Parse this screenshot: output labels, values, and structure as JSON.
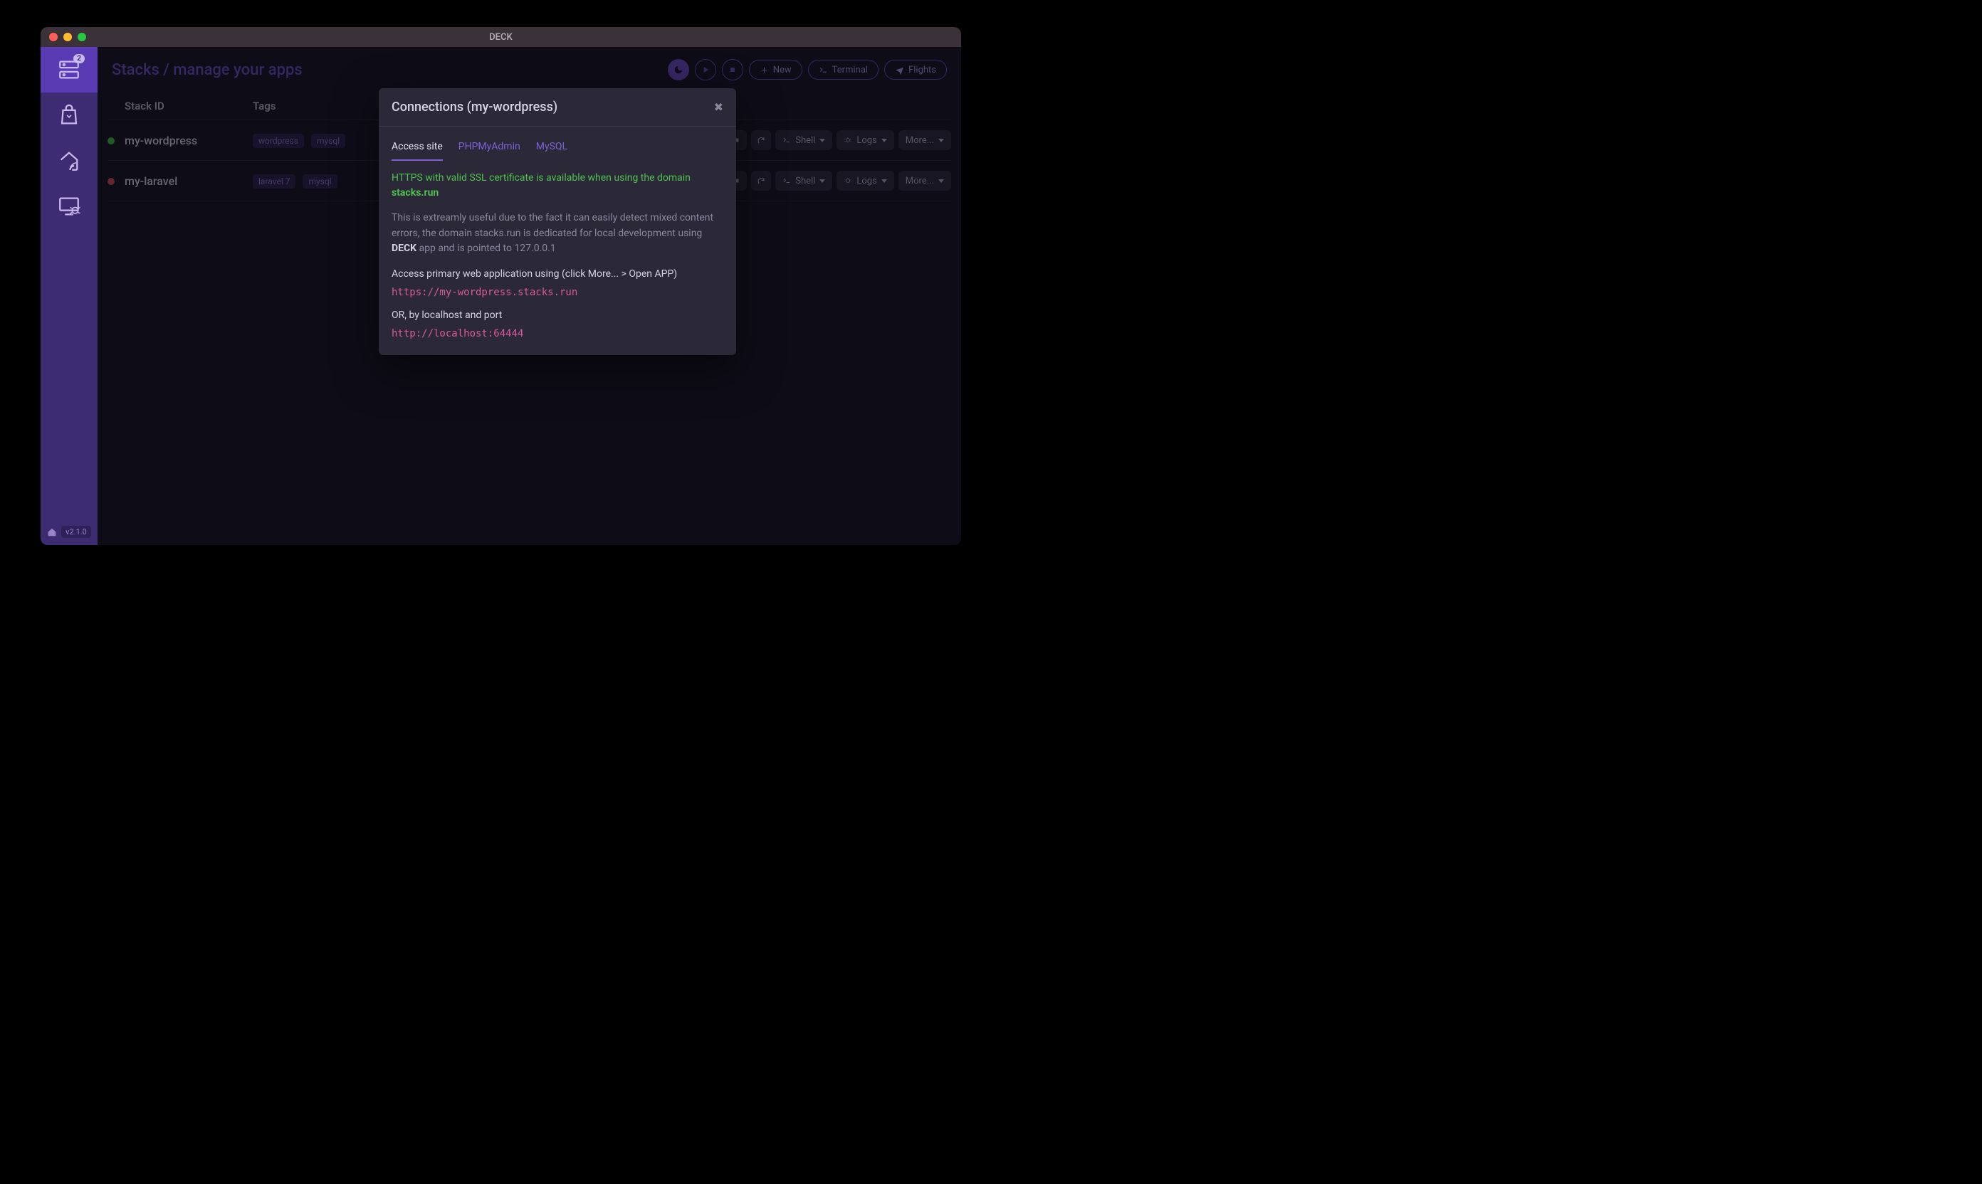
{
  "window": {
    "title": "DECK"
  },
  "sidebar": {
    "badge": "2",
    "version": "v2.1.0"
  },
  "header": {
    "breadcrumb": "Stacks / manage your apps",
    "buttons": {
      "new": "New",
      "terminal": "Terminal",
      "flights": "Flights"
    }
  },
  "table": {
    "columns": {
      "id": "Stack ID",
      "tags": "Tags"
    },
    "action_labels": {
      "shell": "Shell",
      "logs": "Logs",
      "more": "More..."
    },
    "rows": [
      {
        "status": "green",
        "id": "my-wordpress",
        "tags": [
          "wordpress",
          "mysql"
        ]
      },
      {
        "status": "red",
        "id": "my-laravel",
        "tags": [
          "laravel 7",
          "mysql"
        ]
      }
    ]
  },
  "modal": {
    "title": "Connections (my-wordpress)",
    "tabs": {
      "access": "Access site",
      "phpmyadmin": "PHPMyAdmin",
      "mysql": "MySQL"
    },
    "green_line_prefix": "HTTPS with valid SSL certificate is available when using the domain ",
    "green_line_bold": "stacks.run",
    "para_prefix": "This is extreamly useful due to the fact it can easily detect mixed content errors, the domain stacks.run is dedicated for local development using ",
    "para_bold": "DECK",
    "para_suffix": " app and is pointed to 127.0.0.1",
    "access_line": "Access primary web application using (click More... > Open APP)",
    "url_primary": "https://my-wordpress.stacks.run",
    "or_line": "OR, by localhost and port",
    "url_local": "http://localhost:64444"
  }
}
